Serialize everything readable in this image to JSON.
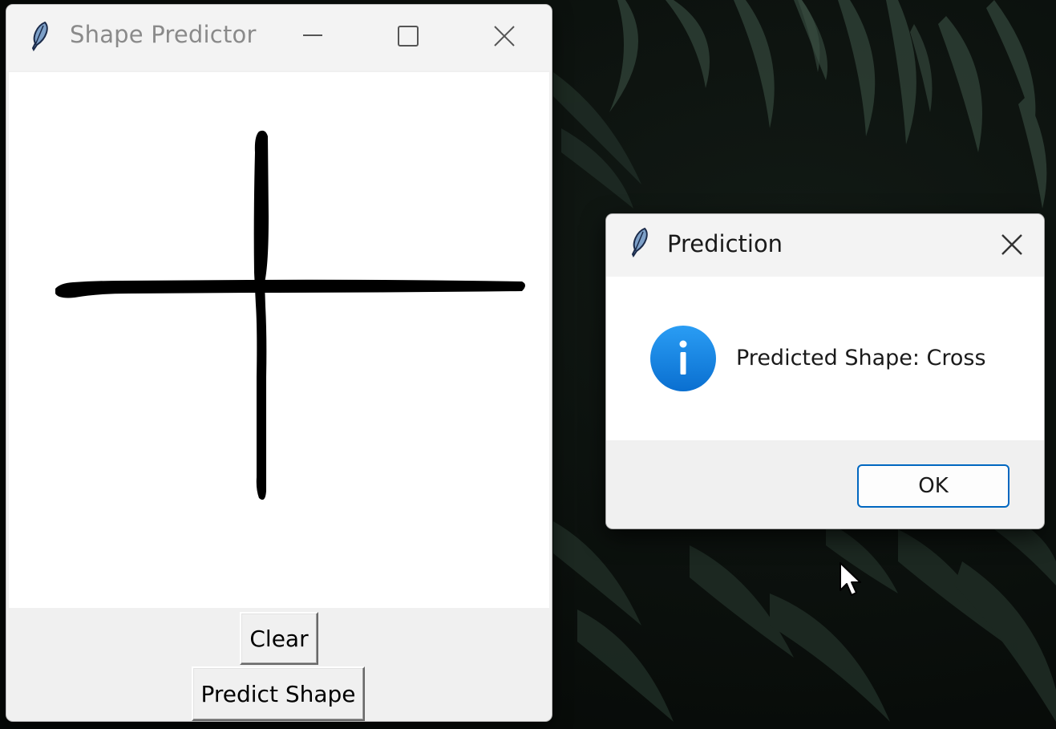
{
  "main_window": {
    "title": "Shape Predictor",
    "icon": "tk-feather-icon",
    "controls": [
      "minimize-icon",
      "maximize-icon",
      "close-icon"
    ],
    "buttons": {
      "clear_label": "Clear",
      "predict_label": "Predict Shape"
    },
    "canvas": {
      "drawing": "cross",
      "stroke_color": "#000000",
      "background": "#ffffff"
    }
  },
  "dialog": {
    "title": "Prediction",
    "icon": "tk-feather-icon",
    "message": "Predicted Shape: Cross",
    "info_icon": "info-icon",
    "ok_label": "OK",
    "accent_color": "#0067c0"
  },
  "desktop": {
    "wallpaper": "dark tropical leaves"
  }
}
